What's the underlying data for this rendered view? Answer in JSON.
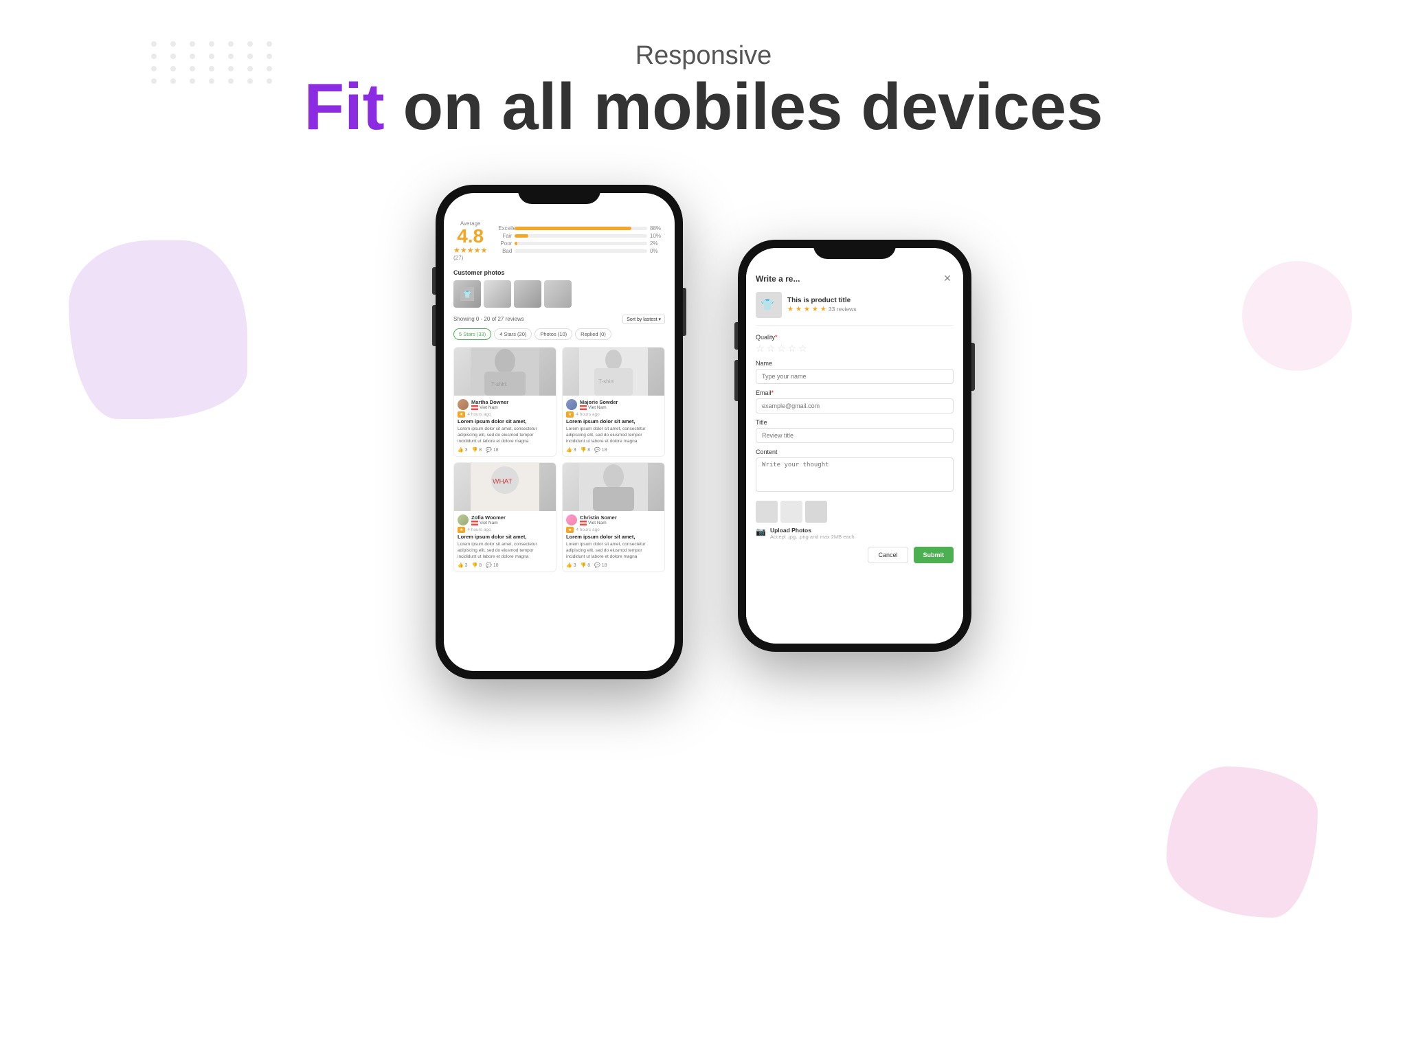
{
  "page": {
    "background_color": "#ffffff"
  },
  "header": {
    "responsive_label": "Responsive",
    "title_purple": "Fit",
    "title_rest": " on all mobiles devices"
  },
  "left_phone": {
    "rating": {
      "avg_label": "Average",
      "avg_value": "4.8",
      "stars": "★★★★★",
      "count": "(27)",
      "bars": [
        {
          "label": "Excellent",
          "pct": "88%",
          "display": "88%"
        },
        {
          "label": "Fair",
          "pct": "10%",
          "display": "10%"
        },
        {
          "label": "Poor",
          "pct": "2%",
          "display": "2%"
        },
        {
          "label": "Bad",
          "pct": "0%",
          "display": "0%"
        }
      ]
    },
    "customer_photos_label": "Customer photos",
    "showing_text": "Showing 0 - 20 of 27 reviews",
    "sort_label": "Sort by lastest ▾",
    "filter_tabs": [
      {
        "label": "5 Stars (33)",
        "active": true
      },
      {
        "label": "4 Stars (20)",
        "active": false
      },
      {
        "label": "Photos (10)",
        "active": false
      },
      {
        "label": "Replied (0)",
        "active": false
      }
    ],
    "reviews": [
      {
        "name": "Martha Downer",
        "country": "Viet Nam",
        "stars": "★",
        "time": "4 hours ago",
        "title": "Lorem ipsum dolor sit amet,",
        "text": "Lorem ipsum dolor sit amet, consectetur adipiscing elit, sed do eiusmod tempor incididunt ut labore et dolore magna",
        "likes": 3,
        "dislikes": 8,
        "comments": 18
      },
      {
        "name": "Majorie Sowder",
        "country": "Viet Nam",
        "stars": "★",
        "time": "4 hours ago",
        "title": "Lorem ipsum dolor sit amet,",
        "text": "Lorem ipsum dolor sit amet, consectetur adipiscing elit, sed do eiusmod tempor incididunt ut labore et dolore magna",
        "likes": 3,
        "dislikes": 8,
        "comments": 18
      },
      {
        "name": "Zofia Woomer",
        "country": "Viet Nam",
        "stars": "★",
        "time": "4 hours ago",
        "title": "Lorem ipsum dolor sit amet,",
        "text": "Lorem ipsum dolor sit amet, consectetur adipiscing elit, sed do eiusmod tempor incididunt ut labore et dolore magna",
        "likes": 3,
        "dislikes": 8,
        "comments": 18
      },
      {
        "name": "Christin Somer",
        "country": "Viet Nam",
        "stars": "★",
        "time": "4 hours ago",
        "title": "Lorem ipsum dolor sit amet,",
        "text": "Lorem ipsum dolor sit amet, consectetur adipiscing elit, sed do eiusmod tempor incididunt ut labore et dolore magna",
        "likes": 3,
        "dislikes": 8,
        "comments": 18
      }
    ]
  },
  "right_phone": {
    "modal_title": "Write a re...",
    "close_icon": "✕",
    "product": {
      "name": "This is product title",
      "reviews_count": "33 reviews",
      "stars": "★★★★★"
    },
    "form": {
      "quality_label": "Quality*",
      "name_label": "Name",
      "name_placeholder": "Type your name",
      "email_label": "Email*",
      "email_placeholder": "example@gmail.com",
      "title_label": "Title",
      "title_placeholder": "Review title",
      "content_label": "Content",
      "content_placeholder": "Write your thought",
      "upload_label": "Upload Photos",
      "upload_hint": "Accept .jpg, .png and max 2MB each.",
      "cancel_label": "Cancel",
      "submit_label": "Submit"
    }
  }
}
